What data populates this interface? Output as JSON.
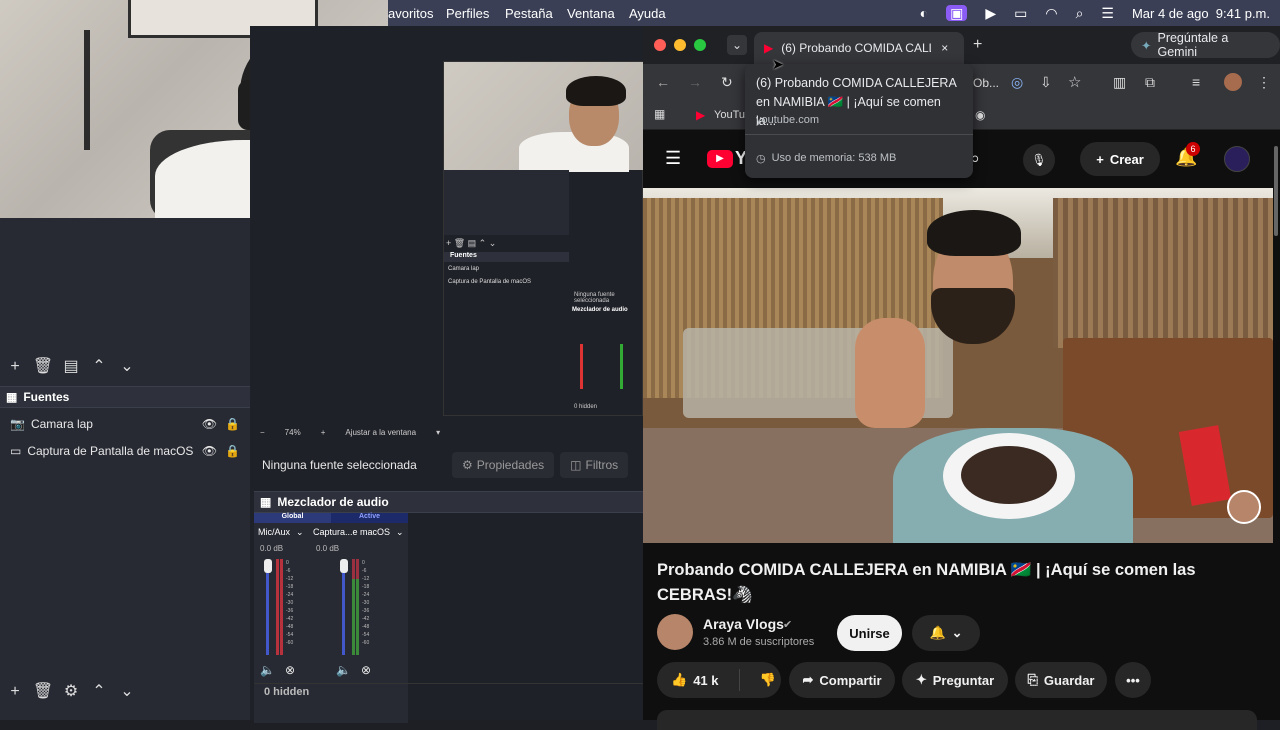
{
  "menubar": {
    "items": [
      "avoritos",
      "Perfiles",
      "Pestaña",
      "Ventana",
      "Ayuda"
    ],
    "datetime": "Mar 4 de ago  9:41 p.m."
  },
  "obs": {
    "preview_zoom": "74%",
    "fit_label": "Ajustar a la ventana",
    "no_source": "Ninguna fuente seleccionada",
    "properties_label": "Propiedades",
    "filters_label": "Filtros",
    "sources_title": "Fuentes",
    "sources": [
      "Camara lap",
      "Captura de Pantalla de macOS"
    ],
    "mixer_title": "Mezclador de audio",
    "mixer_tabs": [
      "Global",
      "Active"
    ],
    "channels": [
      {
        "name": "Mic/Aux",
        "db": "0.0 dB"
      },
      {
        "name": "Captura...e macOS",
        "db": "0.0 dB"
      }
    ],
    "meter_ticks": [
      "0",
      "-6",
      "-12",
      "-18",
      "-24",
      "-30",
      "-36",
      "-42",
      "-48",
      "-54",
      "-60"
    ],
    "hidden_label": "0 hidden",
    "mini": {
      "sources_title": "Fuentes",
      "sources": [
        "Camara lap",
        "Captura de Pantalla de macOS"
      ],
      "no_source": "Ninguna fuente seleccionada",
      "mixer_title": "Mezclador de audio",
      "zoom": "74%",
      "fit": "Ajustar a la ventana",
      "tabs": [
        "Global",
        "Active"
      ],
      "channels": [
        "Mic/Aux",
        "Captura...e macOS"
      ],
      "hidden": "0 hidden"
    }
  },
  "chrome": {
    "tab_title": "(6) Probando COMIDA CALLE",
    "gemini_label": "Pregúntale a Gemini",
    "omnibox_partial": "Ob...",
    "bookmark_partial": "YouTu",
    "tooltip": {
      "title": "(6) Probando COMIDA CALLEJERA en NAMIBIA 🇳🇦 | ¡Aquí se comen la...",
      "domain": "youtube.com",
      "memory": "Uso de memoria: 538 MB"
    }
  },
  "youtube": {
    "logo_text": "Yo",
    "create_label": "Crear",
    "notifications": "6",
    "video_title": "Probando COMIDA CALLEJERA en NAMIBIA 🇳🇦 | ¡Aquí se comen las CEBRAS!🦓",
    "channel": "Araya Vlogs",
    "subscribers": "3.86 M de suscriptores",
    "join_label": "Unirse",
    "likes": "41 k",
    "share_label": "Compartir",
    "ask_label": "Preguntar",
    "save_label": "Guardar",
    "colors": {
      "accent": "#ff0033",
      "badge": "#cc0000"
    }
  }
}
